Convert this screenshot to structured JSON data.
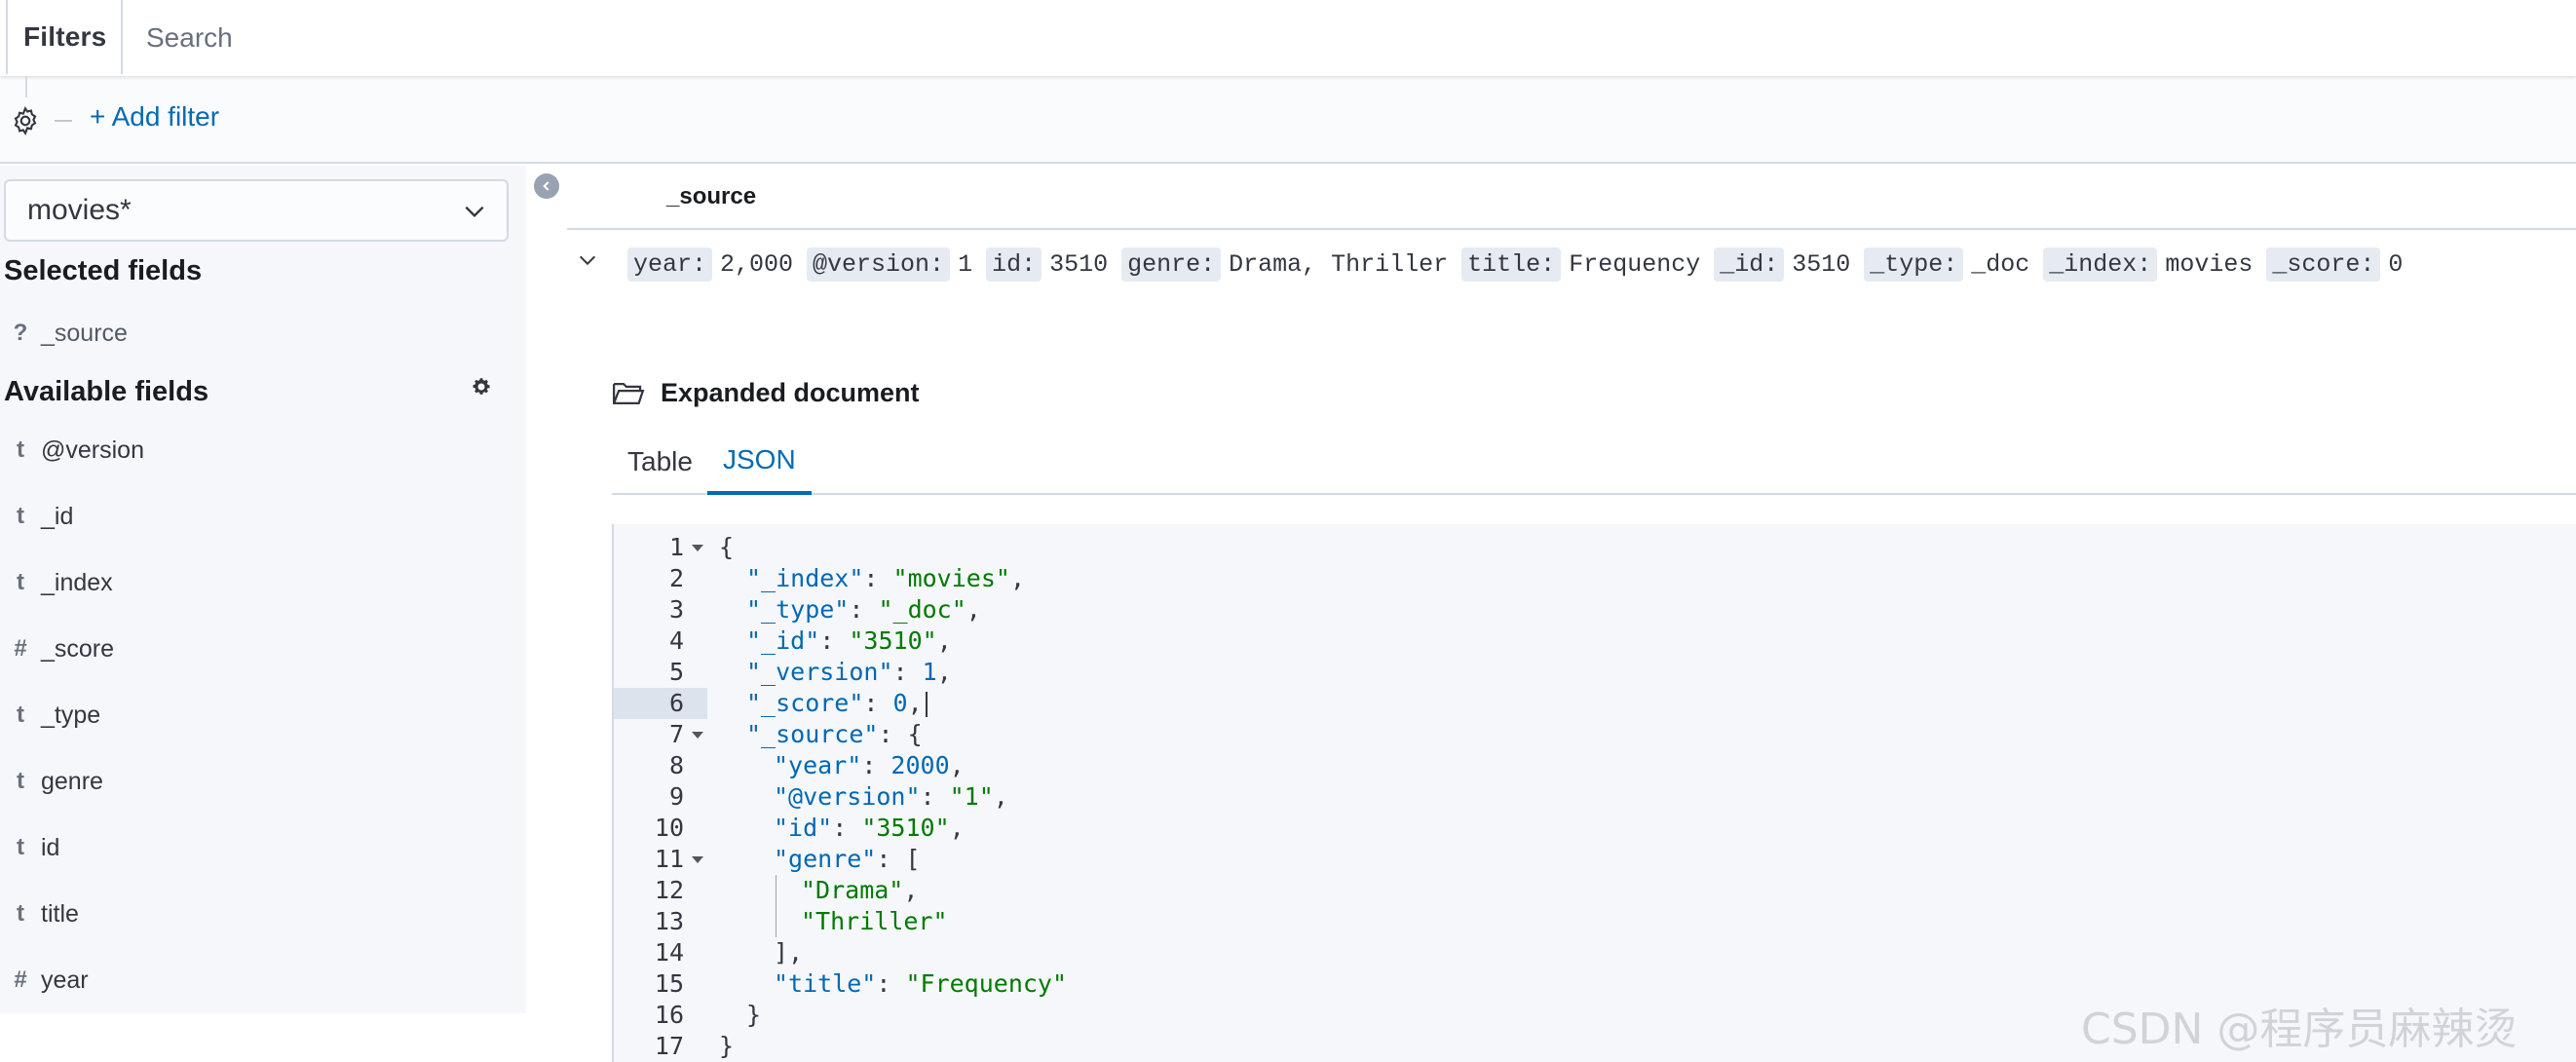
{
  "filter_bar": {
    "filters_label": "Filters",
    "search_placeholder": "Search",
    "add_filter_label": "+ Add filter"
  },
  "sidebar": {
    "index_pattern": "movies*",
    "selected_fields_title": "Selected fields",
    "selected_fields": [
      {
        "type_icon": "?",
        "name": "_source"
      }
    ],
    "available_fields_title": "Available fields",
    "available_fields": [
      {
        "type_icon": "t",
        "name": "@version"
      },
      {
        "type_icon": "t",
        "name": "_id"
      },
      {
        "type_icon": "t",
        "name": "_index"
      },
      {
        "type_icon": "#",
        "name": "_score"
      },
      {
        "type_icon": "t",
        "name": "_type"
      },
      {
        "type_icon": "t",
        "name": "genre"
      },
      {
        "type_icon": "t",
        "name": "id"
      },
      {
        "type_icon": "t",
        "name": "title"
      },
      {
        "type_icon": "#",
        "name": "year"
      }
    ]
  },
  "document": {
    "column_header": "_source",
    "summary": [
      {
        "key": "year:",
        "value": "2,000"
      },
      {
        "key": "@version:",
        "value": "1"
      },
      {
        "key": "id:",
        "value": "3510"
      },
      {
        "key": "genre:",
        "value": "Drama, Thriller"
      },
      {
        "key": "title:",
        "value": "Frequency"
      },
      {
        "key": "_id:",
        "value": "3510"
      },
      {
        "key": "_type:",
        "value": "_doc"
      },
      {
        "key": "_index:",
        "value": "movies"
      },
      {
        "key": "_score:",
        "value": "0"
      }
    ],
    "expanded_title": "Expanded document",
    "tabs": [
      {
        "label": "Table",
        "active": false
      },
      {
        "label": "JSON",
        "active": true
      }
    ],
    "json_lines": [
      {
        "num": "1",
        "fold": true,
        "indent": 0,
        "parts": [
          [
            "p",
            "{"
          ]
        ]
      },
      {
        "num": "2",
        "indent": 1,
        "parts": [
          [
            "k",
            "\"_index\""
          ],
          [
            "p",
            ": "
          ],
          [
            "s",
            "\"movies\""
          ],
          [
            "p",
            ","
          ]
        ]
      },
      {
        "num": "3",
        "indent": 1,
        "parts": [
          [
            "k",
            "\"_type\""
          ],
          [
            "p",
            ": "
          ],
          [
            "s",
            "\"_doc\""
          ],
          [
            "p",
            ","
          ]
        ]
      },
      {
        "num": "4",
        "indent": 1,
        "parts": [
          [
            "k",
            "\"_id\""
          ],
          [
            "p",
            ": "
          ],
          [
            "s",
            "\"3510\""
          ],
          [
            "p",
            ","
          ]
        ]
      },
      {
        "num": "5",
        "indent": 1,
        "parts": [
          [
            "k",
            "\"_version\""
          ],
          [
            "p",
            ": "
          ],
          [
            "n",
            "1"
          ],
          [
            "p",
            ","
          ]
        ]
      },
      {
        "num": "6",
        "current": true,
        "cursor": true,
        "indent": 1,
        "parts": [
          [
            "k",
            "\"_score\""
          ],
          [
            "p",
            ": "
          ],
          [
            "n",
            "0"
          ],
          [
            "p",
            ","
          ]
        ]
      },
      {
        "num": "7",
        "fold": true,
        "indent": 1,
        "parts": [
          [
            "k",
            "\"_source\""
          ],
          [
            "p",
            ": {"
          ]
        ]
      },
      {
        "num": "8",
        "indent": 2,
        "parts": [
          [
            "k",
            "\"year\""
          ],
          [
            "p",
            ": "
          ],
          [
            "n",
            "2000"
          ],
          [
            "p",
            ","
          ]
        ]
      },
      {
        "num": "9",
        "indent": 2,
        "parts": [
          [
            "k",
            "\"@version\""
          ],
          [
            "p",
            ": "
          ],
          [
            "s",
            "\"1\""
          ],
          [
            "p",
            ","
          ]
        ]
      },
      {
        "num": "10",
        "indent": 2,
        "parts": [
          [
            "k",
            "\"id\""
          ],
          [
            "p",
            ": "
          ],
          [
            "s",
            "\"3510\""
          ],
          [
            "p",
            ","
          ]
        ]
      },
      {
        "num": "11",
        "fold": true,
        "indent": 2,
        "parts": [
          [
            "k",
            "\"genre\""
          ],
          [
            "p",
            ": ["
          ]
        ]
      },
      {
        "num": "12",
        "indent": 3,
        "parts": [
          [
            "s",
            "\"Drama\""
          ],
          [
            "p",
            ","
          ]
        ]
      },
      {
        "num": "13",
        "indent": 3,
        "parts": [
          [
            "s",
            "\"Thriller\""
          ]
        ]
      },
      {
        "num": "14",
        "indent": 2,
        "parts": [
          [
            "p",
            "],"
          ]
        ]
      },
      {
        "num": "15",
        "indent": 2,
        "parts": [
          [
            "k",
            "\"title\""
          ],
          [
            "p",
            ": "
          ],
          [
            "s",
            "\"Frequency\""
          ]
        ]
      },
      {
        "num": "16",
        "indent": 1,
        "parts": [
          [
            "p",
            "}"
          ]
        ]
      },
      {
        "num": "17",
        "indent": 0,
        "parts": [
          [
            "p",
            "}"
          ]
        ]
      }
    ]
  },
  "watermark": "CSDN @程序员麻辣烫",
  "colors": {
    "link": "#006bb4",
    "json_key": "#0068b3",
    "json_string": "#007a00"
  }
}
